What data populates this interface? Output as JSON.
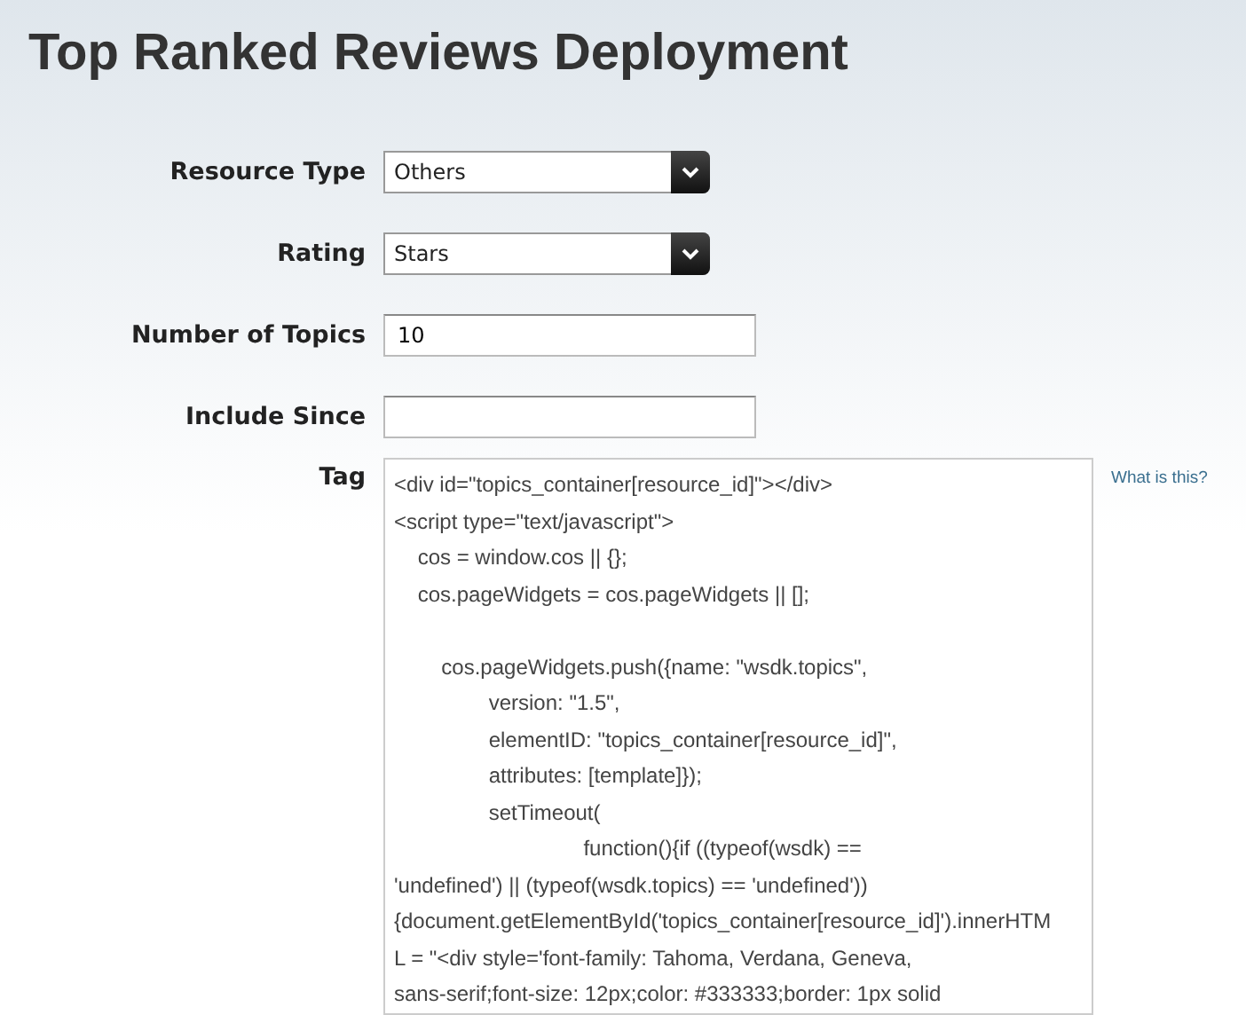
{
  "title": "Top Ranked Reviews Deployment",
  "fields": [
    {
      "kind": "select",
      "label": "Resource Type",
      "value": "Others"
    },
    {
      "kind": "select",
      "label": "Rating",
      "value": "Stars"
    },
    {
      "kind": "text",
      "label": "Number of Topics",
      "value": "10"
    },
    {
      "kind": "text",
      "label": "Include Since"
    }
  ],
  "tag": {
    "label": "Tag",
    "help_link": "What is this?",
    "code_blocks": [
      [
        "<div id=\"topics_container[resource_id]\"></div>",
        "<script type=\"text/javascript\">",
        "    cos = window.cos || {};",
        "    cos.pageWidgets = cos.pageWidgets || [];"
      ],
      [
        "        cos.pageWidgets.push({name: \"wsdk.topics\",",
        "                version: \"1.5\",",
        "                elementID: \"topics_container[resource_id]\",",
        "                attributes: [template]});",
        "                setTimeout(",
        "                                function(){if ((typeof(wsdk) ==",
        "'undefined') || (typeof(wsdk.topics) == 'undefined'))",
        "{document.getElementById('topics_container[resource_id]').innerHTM",
        "L = \"<div style='font-family: Tahoma, Verdana, Geneva,",
        "sans-serif;font-size: 12px;color: #333333;border: 1px solid"
      ]
    ]
  }
}
